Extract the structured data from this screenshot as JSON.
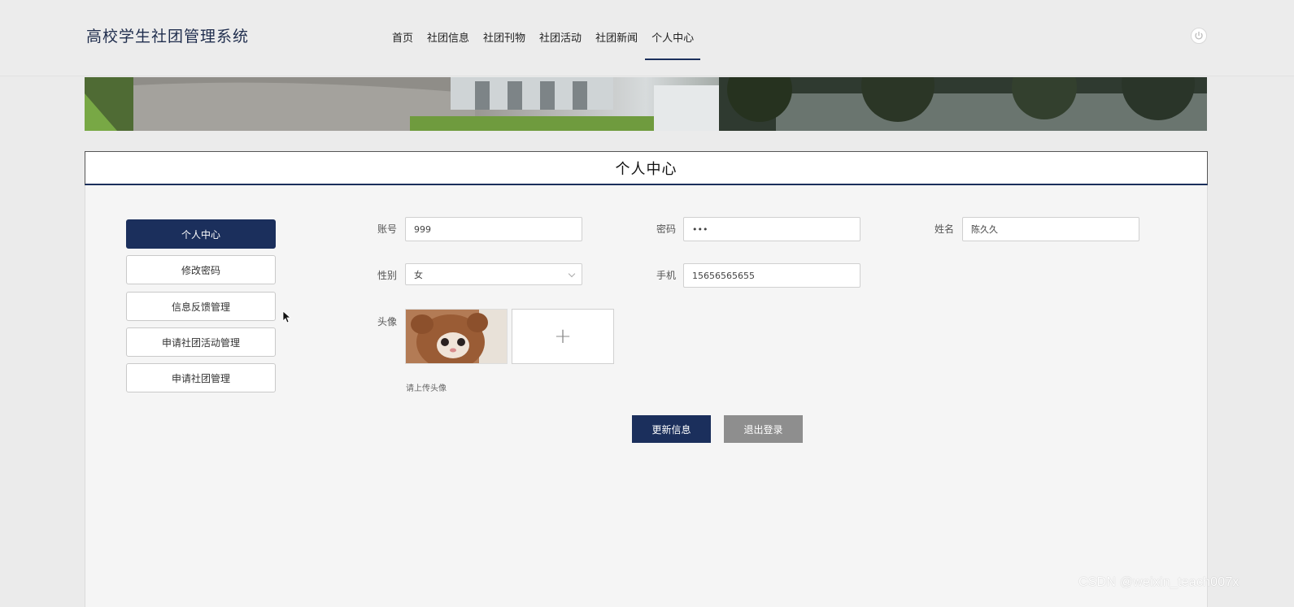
{
  "header": {
    "brand": "高校学生社团管理系统",
    "nav": [
      {
        "label": "首页"
      },
      {
        "label": "社团信息"
      },
      {
        "label": "社团刊物"
      },
      {
        "label": "社团活动"
      },
      {
        "label": "社团新闻"
      },
      {
        "label": "个人中心",
        "active": true
      }
    ],
    "power_icon": "power-icon"
  },
  "section": {
    "title": "个人中心"
  },
  "sidebar": {
    "items": [
      {
        "label": "个人中心",
        "active": true
      },
      {
        "label": "修改密码"
      },
      {
        "label": "信息反馈管理"
      },
      {
        "label": "申请社团活动管理"
      },
      {
        "label": "申请社团管理"
      }
    ]
  },
  "form": {
    "account": {
      "label": "账号",
      "value": "999"
    },
    "password": {
      "label": "密码",
      "value": "•••"
    },
    "name": {
      "label": "姓名",
      "value": "陈久久"
    },
    "gender": {
      "label": "性别",
      "value": "女"
    },
    "phone": {
      "label": "手机",
      "value": "15656565655"
    },
    "avatar": {
      "label": "头像",
      "upload_symbol": "+",
      "hint": "请上传头像"
    },
    "update_button": "更新信息",
    "logout_button": "退出登录"
  },
  "watermark": "CSDN @weixin_teach007x",
  "colors": {
    "accent": "#1b2f5c",
    "secondary_button": "#8e8e8e",
    "page_background": "#ebebeb"
  }
}
